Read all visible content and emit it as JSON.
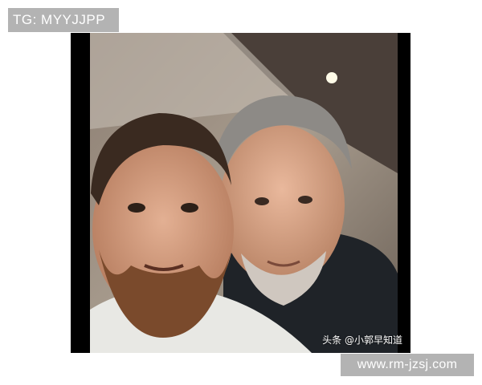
{
  "overlay_top": {
    "text": "TG: MYYJJPP"
  },
  "photo": {
    "watermark": "头条 @小郭早知道",
    "colors": {
      "frame": "#000000",
      "tag_bg": "#b3b3b3"
    }
  },
  "overlay_bottom": {
    "text": "www.rm-jzsj.com"
  }
}
